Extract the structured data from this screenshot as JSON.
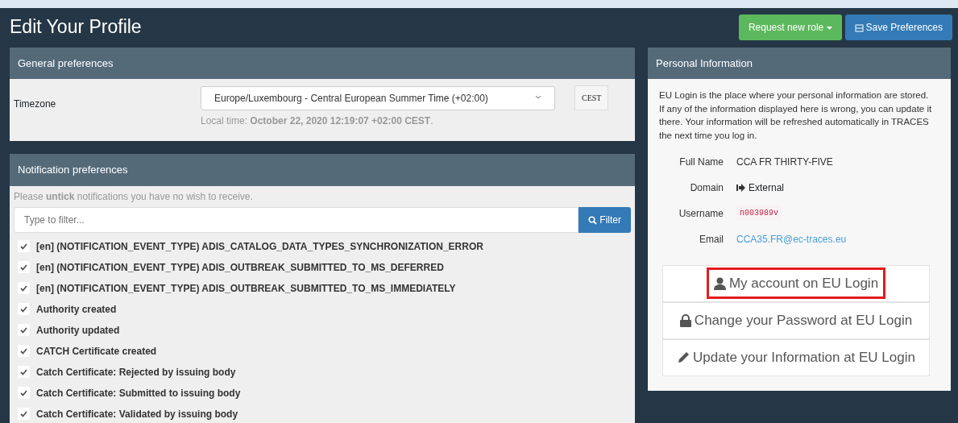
{
  "title": "Edit Your Profile",
  "buttons": [
    {
      "label": "Request new role",
      "kind": "dropdown"
    },
    {
      "label": "Save Preferences",
      "kind": "save"
    }
  ],
  "general": {
    "title": "General preferences",
    "timezone_label": "Timezone",
    "timezone_value": "Europe/Luxembourg - Central European Summer Time (+02:00)",
    "zone_abbr": "CEST",
    "local_time": "Local time: **October 22, 2020 12:19:07 +02:00 CEST**."
  },
  "notifications": {
    "title": "Notification preferences",
    "hint": "Please **untick** notifications you have no wish to receive.",
    "filter": {
      "placeholder": "Type to filter...",
      "button": "Filter"
    },
    "items": [
      {
        "label": "[en] (NOTIFICATION_EVENT_TYPE) ADIS_CATALOG_DATA_TYPES_SYNCHRONIZATION_ERROR",
        "checked": true
      },
      {
        "label": "[en] (NOTIFICATION_EVENT_TYPE) ADIS_OUTBREAK_SUBMITTED_TO_MS_DEFERRED",
        "checked": true
      },
      {
        "label": "[en] (NOTIFICATION_EVENT_TYPE) ADIS_OUTBREAK_SUBMITTED_TO_MS_IMMEDIATELY",
        "checked": true
      },
      {
        "label": "Authority created",
        "checked": true
      },
      {
        "label": "Authority updated",
        "checked": true
      },
      {
        "label": "CATCH Certificate created",
        "checked": true
      },
      {
        "label": "Catch Certificate: Rejected by issuing body",
        "checked": true
      },
      {
        "label": "Catch Certificate: Submitted to issuing body",
        "checked": true
      },
      {
        "label": "Catch Certificate: Validated by issuing body",
        "checked": true
      }
    ]
  },
  "personal": {
    "title": "Personal Information",
    "intro": "EU Login is the place where your personal information are stored. If any of the information displayed here is wrong, you can update it there. Your information will be refreshed automatically in TRACES the next time you log in.",
    "fields": [
      {
        "label": "Full Name",
        "value": "CCA FR THIRTY-FIVE",
        "kind": "text"
      },
      {
        "label": "Domain",
        "value": "External",
        "kind": "domain"
      },
      {
        "label": "Username",
        "value": "n003989v",
        "kind": "code"
      },
      {
        "label": "Email",
        "value": "CCA35.FR@ec-traces.eu",
        "kind": "email"
      }
    ],
    "links": [
      {
        "label": "My account on EU Login",
        "kind": "user",
        "highlighted": true
      },
      {
        "label": "Change your Password at EU Login",
        "kind": "lock",
        "highlighted": false
      },
      {
        "label": "Update your Information at EU Login",
        "kind": "pencil",
        "highlighted": false
      }
    ]
  }
}
